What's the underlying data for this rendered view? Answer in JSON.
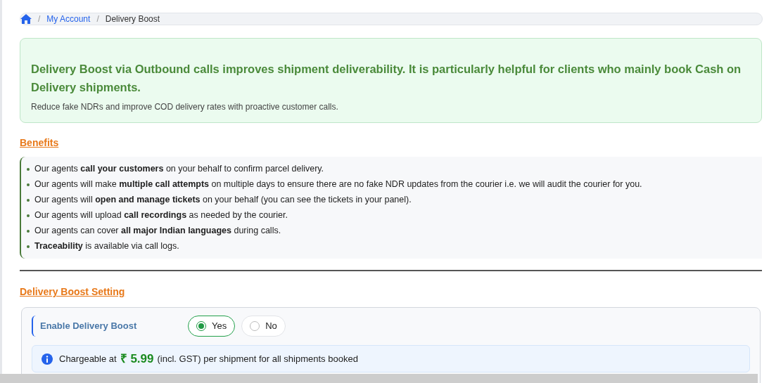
{
  "breadcrumb": [
    {
      "label": "My Account",
      "kind": "link",
      "separator": "/"
    },
    {
      "label": "Delivery Boost",
      "kind": "current",
      "separator": "/"
    }
  ],
  "intro": {
    "headline": "Delivery Boost via Outbound calls improves shipment deliverability. It is particularly helpful for clients who mainly book Cash on Delivery shipments.",
    "subtext": "Reduce fake NDRs and improve COD delivery rates with proactive customer calls."
  },
  "benefits": {
    "title": "Benefits",
    "items": [
      "Our agents **call your customers** on your behalf to confirm parcel delivery.",
      "Our agents will make **multiple call attempts** on multiple days to ensure there are no fake NDR updates from the courier i.e. we will audit the courier for you.",
      "Our agents will **open and manage tickets** on your behalf (you can see the tickets in your panel).",
      "Our agents will upload **call recordings** as needed by the courier.",
      "Our agents can cover **all major Indian languages** during calls.",
      "**Traceability** is available via call logs."
    ]
  },
  "setting": {
    "title": "Delivery Boost Setting",
    "label": "Enable Delivery Boost",
    "options": [
      {
        "label": "Yes",
        "selected": true
      },
      {
        "label": "No",
        "selected": false
      }
    ],
    "charge": {
      "prefix": "Chargeable at",
      "price": "₹ 5.99",
      "suffix": "(incl. GST) per shipment for all shipments booked"
    }
  }
}
